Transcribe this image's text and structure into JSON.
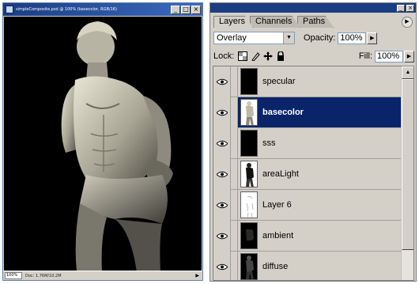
{
  "document": {
    "title": "simpleComposite.psd @ 100% (basecolor, RGB/16)",
    "zoom": "100%",
    "doc_info": "Doc: 1.76M/10.2M"
  },
  "panel": {
    "tabs": [
      "Layers",
      "Channels",
      "Paths"
    ],
    "active_tab": "Layers",
    "blend_mode": "Overlay",
    "opacity_label": "Opacity:",
    "opacity_value": "100%",
    "lock_label": "Lock:",
    "fill_label": "Fill:",
    "fill_value": "100%",
    "layers": [
      {
        "name": "specular",
        "visible": true,
        "selected": false
      },
      {
        "name": "basecolor",
        "visible": true,
        "selected": true
      },
      {
        "name": "sss",
        "visible": true,
        "selected": false
      },
      {
        "name": "areaLight",
        "visible": true,
        "selected": false
      },
      {
        "name": "Layer 6",
        "visible": true,
        "selected": false
      },
      {
        "name": "ambient",
        "visible": true,
        "selected": false
      },
      {
        "name": "diffuse",
        "visible": true,
        "selected": false
      }
    ]
  },
  "icons": {
    "eye": "eye-icon",
    "lock_transparency": "lock-transparent-pixels-icon",
    "lock_paint": "lock-image-pixels-icon",
    "lock_move": "lock-position-icon",
    "lock_all": "lock-all-icon",
    "dropdown": "chevron-down-icon",
    "slider_arrow": "triangle-right-icon",
    "palette_menu": "palette-menu-icon"
  },
  "colors": {
    "selected_row": "#0a246a",
    "panel_bg": "#d4d0c8",
    "titlebar": "#1b3d82",
    "canvas_bg": "#000000"
  }
}
